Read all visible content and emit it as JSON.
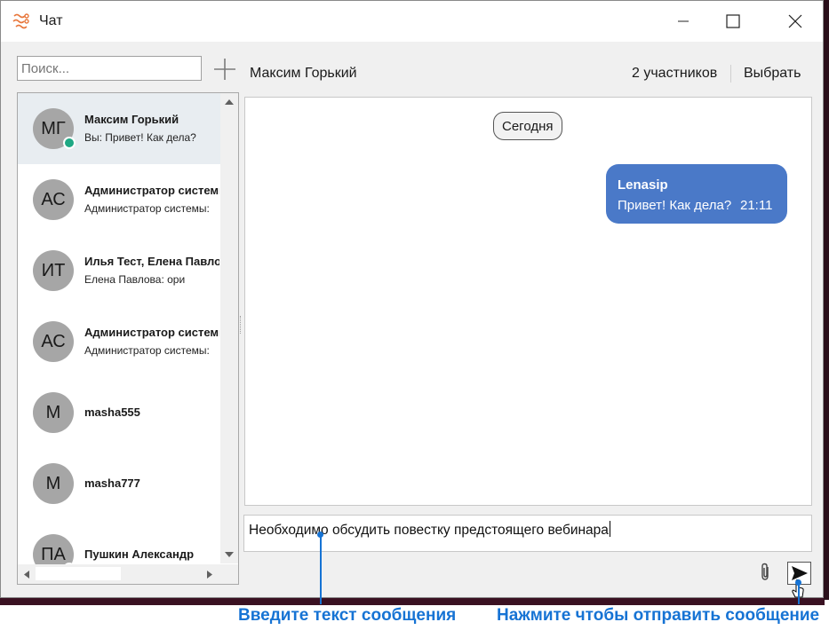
{
  "window": {
    "title": "Чат"
  },
  "search": {
    "placeholder": "Поиск..."
  },
  "header": {
    "contact_name": "Максим Горький",
    "participants": "2 участников",
    "select_label": "Выбрать"
  },
  "chats": [
    {
      "initials": "МГ",
      "name": "Максим Горький",
      "preview": "Вы: Привет! Как дела?",
      "online": true,
      "active": true
    },
    {
      "initials": "АС",
      "name": "Администратор системы",
      "preview": "Администратор системы:",
      "online": false
    },
    {
      "initials": "ИТ",
      "name": "Илья Тест, Елена Павлова",
      "preview": "Елена Павлова: ори",
      "online": false
    },
    {
      "initials": "АС",
      "name": "Администратор системы",
      "preview": "Администратор системы:",
      "online": false
    },
    {
      "initials": "М",
      "name": "masha555",
      "preview": "",
      "online": false
    },
    {
      "initials": "М",
      "name": "masha777",
      "preview": "",
      "online": false
    },
    {
      "initials": "ПА",
      "name": "Пушкин Александр",
      "preview": "",
      "online": true
    }
  ],
  "messages": {
    "date_label": "Сегодня",
    "items": [
      {
        "author": "Lenasip",
        "text": "Привет! Как дела?",
        "time": "21:11",
        "outgoing": true
      }
    ]
  },
  "composer": {
    "value": "Необходимо обсудить повестку предстоящего вебинара"
  },
  "annotations": {
    "input_hint": "Введите текст сообщения",
    "send_hint": "Нажмите чтобы отправить сообщение"
  },
  "colors": {
    "bubble": "#4a79c8",
    "online": "#1fa884",
    "annotation": "#1673d4",
    "app_icon": "#e8763a"
  },
  "icons": {
    "app": "chat-app-icon",
    "add": "plus-icon",
    "attach": "paperclip-icon",
    "send": "send-icon"
  }
}
